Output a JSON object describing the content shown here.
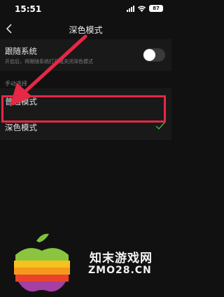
{
  "status_bar": {
    "time": "15:51",
    "battery": "87"
  },
  "nav": {
    "title": "深色模式"
  },
  "follow_system": {
    "title": "跟随系统",
    "description": "开启后，将跟随系统打开或关闭深色模式",
    "enabled": false
  },
  "manual": {
    "section_label": "手动选择",
    "options": [
      {
        "label": "普通模式",
        "selected": false
      },
      {
        "label": "深色模式",
        "selected": true
      }
    ]
  },
  "colors": {
    "highlight": "#e52844",
    "check": "#4cae4c",
    "background": "#111111"
  },
  "watermark": {
    "name": "知末游戏网",
    "domain": "ZMO28.CN"
  }
}
